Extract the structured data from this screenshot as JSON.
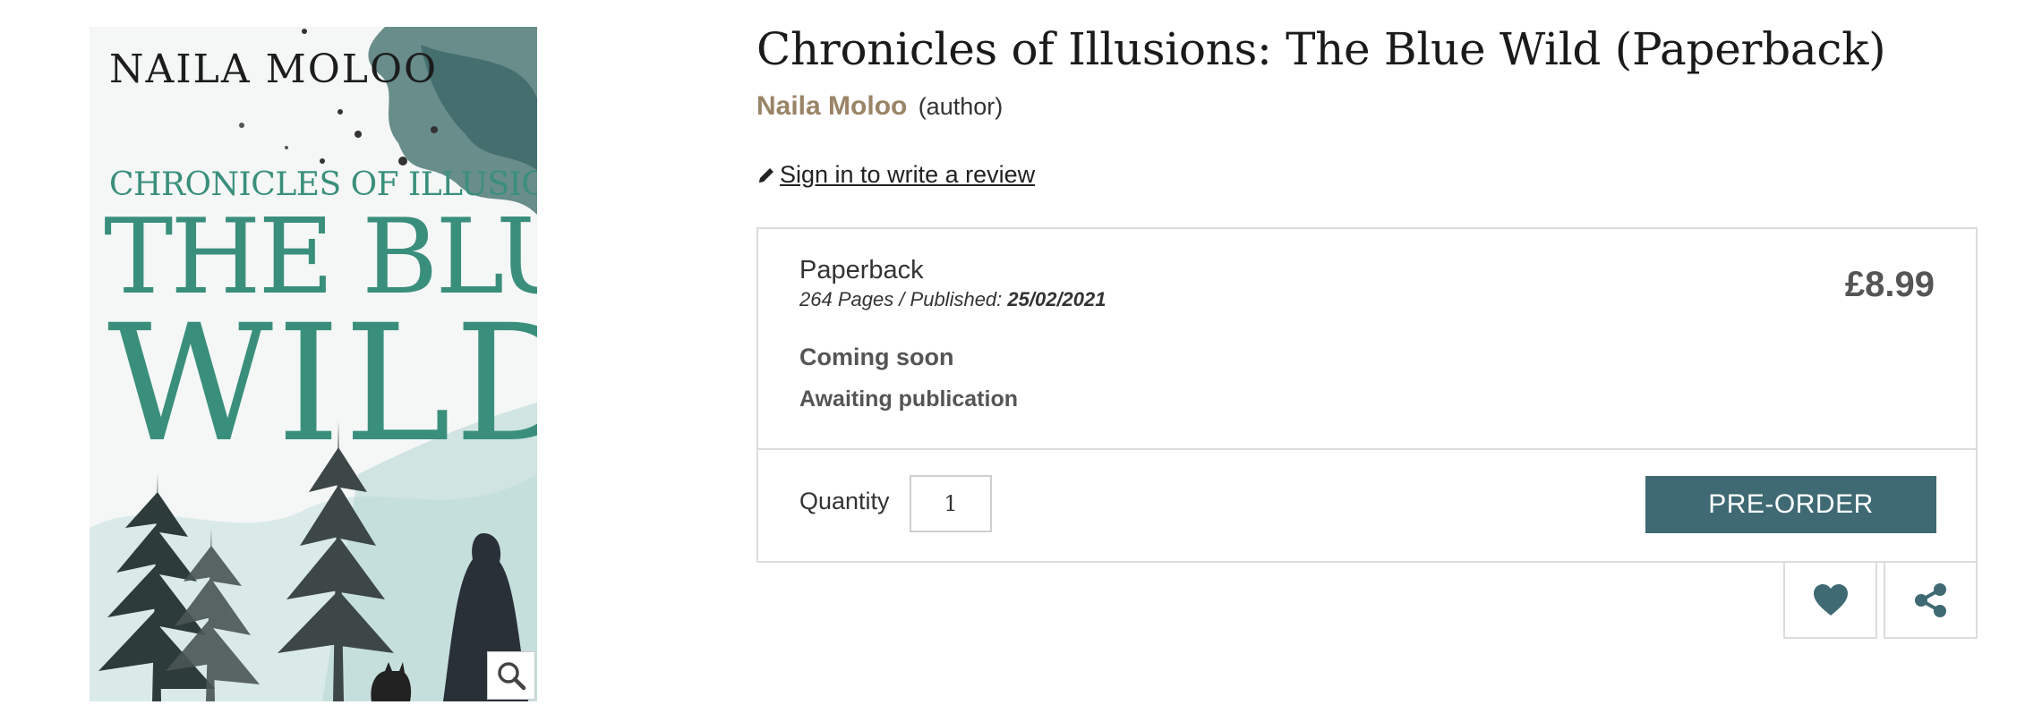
{
  "cover": {
    "author": "NAILA MOLOO",
    "series": "CHRONICLES OF ILLUSIONS",
    "title_line1": "THE BLUE",
    "title_line2": "WILD",
    "zoom_icon": "magnifier-icon"
  },
  "product": {
    "title": "Chronicles of Illusions: The Blue Wild (Paperback)",
    "author_name": "Naila Moloo",
    "author_role": "(author)",
    "review_link": "Sign in to write a review",
    "review_icon": "pencil-icon"
  },
  "offer": {
    "format": "Paperback",
    "meta_prefix": "264 Pages / Published: ",
    "published_date": "25/02/2021",
    "status": "Coming soon",
    "availability": "Awaiting publication",
    "price": "£8.99",
    "quantity_label": "Quantity",
    "quantity_value": "1",
    "preorder_label": "PRE-ORDER"
  },
  "actions": {
    "wishlist_icon": "heart-icon",
    "share_icon": "share-icon"
  },
  "colors": {
    "accent": "#3f6a73",
    "author_link": "#9a8466",
    "cover_teal": "#3a8f7c"
  }
}
